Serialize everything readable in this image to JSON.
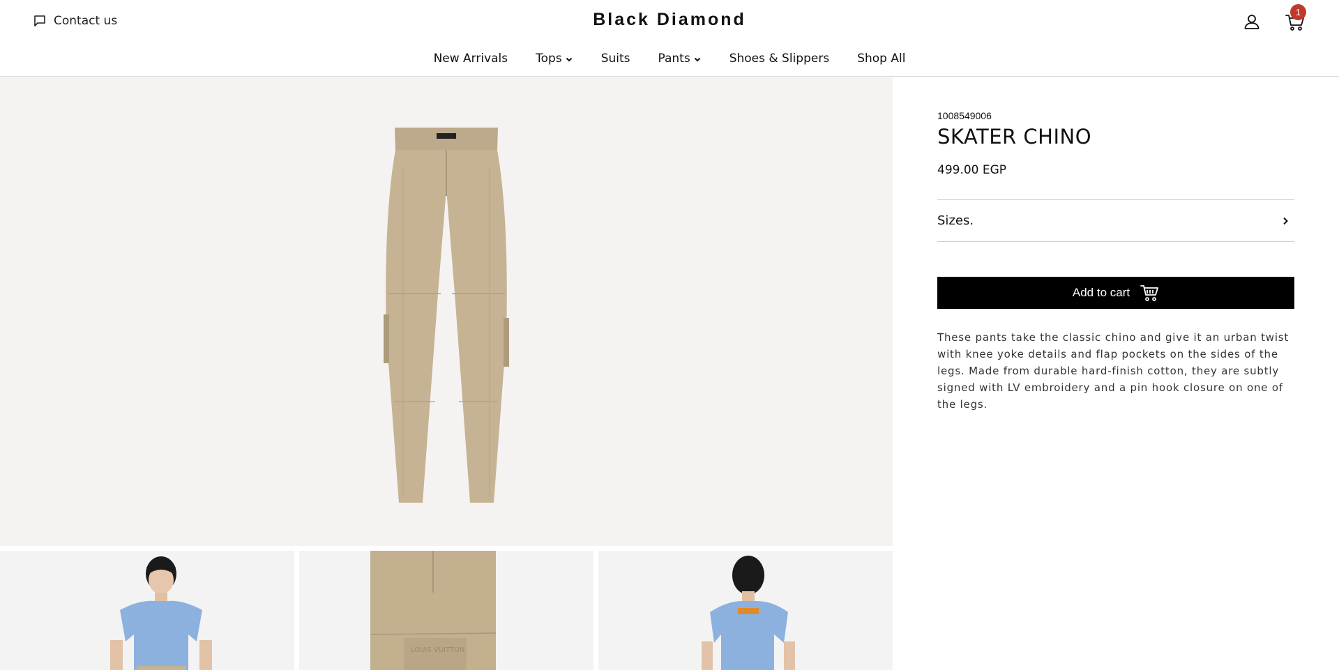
{
  "header": {
    "contact_label": "Contact us",
    "brand": "Black Diamond",
    "cart_count": "1",
    "badge_color": "#c0392b"
  },
  "nav": {
    "items": [
      {
        "label": "New Arrivals",
        "has_dropdown": false
      },
      {
        "label": "Tops",
        "has_dropdown": true
      },
      {
        "label": "Suits",
        "has_dropdown": false
      },
      {
        "label": "Pants",
        "has_dropdown": true
      },
      {
        "label": "Shoes & Slippers",
        "has_dropdown": false
      },
      {
        "label": "Shop All",
        "has_dropdown": false
      }
    ]
  },
  "gallery": {
    "main": "khaki-cargo-pants-icon",
    "thumbnails": [
      "model-front-blue-tee",
      "pants-leg-detail",
      "model-back-blue-tee"
    ]
  },
  "product": {
    "sku": "1008549006",
    "title": "SKATER CHINO",
    "price": "499.00 EGP",
    "sizes_label": "Sizes.",
    "add_to_cart_label": "Add to cart",
    "description": "These pants take the classic chino and give it an urban twist with knee yoke details and flap pockets on the sides of the legs. Made from durable hard-finish cotton, they are subtly signed with LV embroidery and a pin hook closure on one of the legs."
  }
}
